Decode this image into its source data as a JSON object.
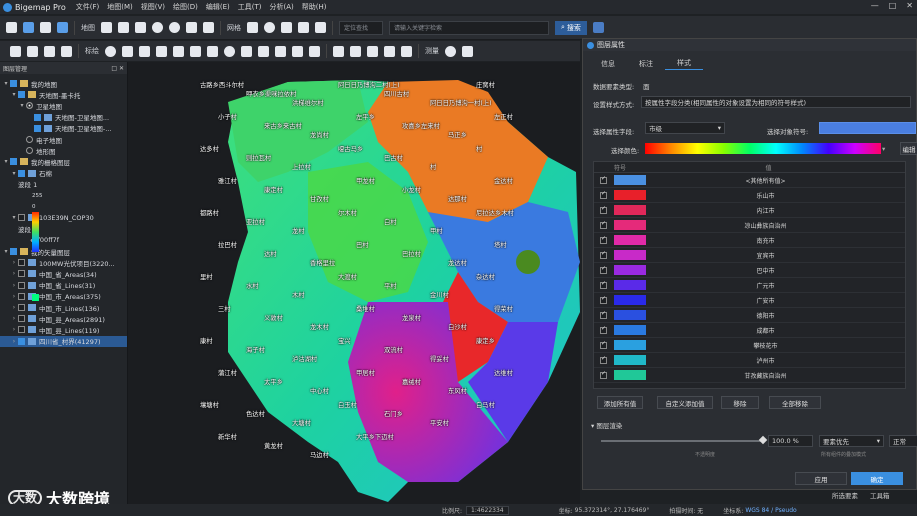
{
  "app": {
    "title": "Bigemap Pro",
    "menu": [
      "文件(F)",
      "地图(M)",
      "视图(V)",
      "绘图(D)",
      "编辑(E)",
      "工具(T)",
      "分析(A)",
      "帮助(H)"
    ]
  },
  "toolbar1": {
    "map_label": "地图",
    "grid_label": "网格",
    "search_mode": "定位查找",
    "search_placeholder": "请输入关键字检索",
    "search_btn": "搜索"
  },
  "toolbar2": {
    "mark_label": "标绘",
    "measure_label": "测量"
  },
  "sidebar": {
    "header": "图层管理",
    "rows": [
      {
        "indent": 1,
        "exp": "▾",
        "cb": true,
        "icon": "folder",
        "label": "我的地图"
      },
      {
        "indent": 2,
        "exp": "▾",
        "cb": true,
        "icon": "folder",
        "label": "天地图-墨卡托"
      },
      {
        "indent": 3,
        "exp": "▾",
        "radio": true,
        "on": true,
        "label": "卫星地图"
      },
      {
        "indent": 4,
        "exp": "",
        "cb": true,
        "icon": "layer",
        "label": "天地图-卫星地图..."
      },
      {
        "indent": 4,
        "exp": "",
        "cb": true,
        "icon": "layer",
        "label": "天地图-卫星地图-..."
      },
      {
        "indent": 3,
        "exp": "",
        "radio": true,
        "on": false,
        "label": "电子地图"
      },
      {
        "indent": 3,
        "exp": "",
        "radio": true,
        "on": false,
        "label": "地形图"
      },
      {
        "indent": 1,
        "exp": "▾",
        "cb": true,
        "icon": "folder",
        "label": "我的栅格图层"
      },
      {
        "indent": 2,
        "exp": "▾",
        "cb": true,
        "icon": "layer",
        "label": "石棉"
      },
      {
        "indent": 2,
        "exp": "",
        "label": "波段 1"
      },
      {
        "indent": 2,
        "exp": "",
        "label": "255"
      },
      {
        "indent": 2,
        "exp": "",
        "label": "0"
      },
      {
        "indent": 2,
        "exp": "▾",
        "cb": false,
        "icon": "layer",
        "label": "103E39N_COP30"
      },
      {
        "indent": 2,
        "exp": "",
        "label": "波段 1"
      },
      {
        "indent": 2,
        "exp": "",
        "label": "#ff00ff7f"
      },
      {
        "indent": 1,
        "exp": "▾",
        "cb": true,
        "icon": "folder",
        "label": "我的矢量图层"
      },
      {
        "indent": 2,
        "exp": "›",
        "cb": false,
        "icon": "layer",
        "label": "100MW光伏项目(3220..."
      },
      {
        "indent": 2,
        "exp": "›",
        "cb": false,
        "icon": "layer",
        "label": "中国_省_Areas(34)"
      },
      {
        "indent": 2,
        "exp": "›",
        "cb": false,
        "icon": "layer",
        "label": "中国_省_Lines(31)"
      },
      {
        "indent": 2,
        "exp": "›",
        "cb": false,
        "icon": "layer",
        "label": "中国_市_Areas(375)"
      },
      {
        "indent": 2,
        "exp": "›",
        "cb": false,
        "icon": "layer",
        "label": "中国_市_Lines(136)"
      },
      {
        "indent": 2,
        "exp": "›",
        "cb": false,
        "icon": "layer",
        "label": "中国_县_Areas(2891)"
      },
      {
        "indent": 2,
        "exp": "›",
        "cb": false,
        "icon": "layer",
        "label": "中国_县_Lines(119)"
      },
      {
        "indent": 2,
        "exp": "›",
        "cb": true,
        "icon": "layer",
        "label": "四川省_村界(41297)",
        "selected": true
      }
    ]
  },
  "map_labels": [
    "古路乡西斗尔村",
    "呷衣乡渠咪拉依村",
    "洪梯维尔村",
    "阿日日乃博沟二村(上)",
    "四川古村",
    "阿日日乃博沟一村(上)",
    "庄窝村",
    "小子村",
    "来古乡来古村",
    "龙尚村",
    "左平乡",
    "攻喜乡左来村",
    "马正乡",
    "左正村",
    "达多村",
    "则拉瓦村",
    "上拉村",
    "嗄古马乡",
    "巴古村",
    "村",
    "村",
    "雅江村",
    "康定村",
    "甘孜村",
    "甲龙村",
    "小龙村",
    "达那村",
    "金达村",
    "都路村",
    "亚拉村",
    "龙村",
    "尔木村",
    "白村",
    "甲村",
    "尼拉达乡木村",
    "拉巴村",
    "达村",
    "香格里拉",
    "巴村",
    "巴拉村",
    "龙达村",
    "塔村",
    "里村",
    "水村",
    "木村",
    "大渡村",
    "平村",
    "金川村",
    "杂达村",
    "三村",
    "义敦村",
    "龙木村",
    "桑堆村",
    "龙泉村",
    "白沙村",
    "得荣村",
    "康村",
    "海子村",
    "泸沽湖村",
    "宝兴",
    "双流村",
    "得妥村",
    "康定乡",
    "蒲江村",
    "太平乡",
    "中心村",
    "甲居村",
    "嘉绒村",
    "东风村",
    "达维村",
    "壤塘村",
    "色达村",
    "大塘村",
    "白玉村",
    "石门乡",
    "平安村",
    "白马村",
    "新华村",
    "黄龙村",
    "马边村",
    "大平乡下迈村"
  ],
  "status": {
    "scale_label": "比例尺:",
    "scale": "1:4622334",
    "coords_label": "坐标:",
    "coords": "95.372314°, 27.176469°",
    "alt_label": "拍摄时间: 无",
    "crs_label": "坐标系:",
    "crs": "WGS 84 / Pseudo"
  },
  "watermark": {
    "logo": "大数",
    "text": "大数跨境"
  },
  "dialog": {
    "title": "图层属性",
    "tabs": [
      "信息",
      "标注",
      "样式"
    ],
    "data_type_label": "数据要素类型:",
    "data_type_value": "面",
    "style_mode_label": "设置样式方式:",
    "style_mode_value": "按属性字段分类(相同属性的对象设置为相同的符号样式)",
    "field_label": "选择属性字段:",
    "field_value": "市级",
    "symbol_label": "选择对象符号:",
    "color_label": "选择颜色:",
    "edit_label": "编辑",
    "table_head": {
      "symbol": "符号",
      "value": "值"
    },
    "table_rows": [
      {
        "color": "#4a90e2",
        "value": "<其他所有值>"
      },
      {
        "color": "#e8202a",
        "value": "乐山市"
      },
      {
        "color": "#e0285a",
        "value": "内江市"
      },
      {
        "color": "#e52a7a",
        "value": "凉山彝族自治州"
      },
      {
        "color": "#e02aa8",
        "value": "南充市"
      },
      {
        "color": "#c82ac8",
        "value": "宜宾市"
      },
      {
        "color": "#9a2ae0",
        "value": "巴中市"
      },
      {
        "color": "#5a2ae8",
        "value": "广元市"
      },
      {
        "color": "#2a2ae8",
        "value": "广安市"
      },
      {
        "color": "#2a50e0",
        "value": "德阳市"
      },
      {
        "color": "#2a7ae0",
        "value": "成都市"
      },
      {
        "color": "#2aa0e0",
        "value": "攀枝花市"
      },
      {
        "color": "#20b8c8",
        "value": "泸州市"
      },
      {
        "color": "#20c898",
        "value": "甘孜藏族自治州"
      }
    ],
    "btn_add_all": "添加所有值",
    "btn_add_custom": "自定义添加值",
    "btn_remove": "移除",
    "btn_remove_all": "全部移除",
    "render_label": "图层渲染",
    "opacity_value": "100.0 %",
    "priority_value": "要素优先",
    "normal_value": "正常",
    "opacity_hint": "不透明度",
    "priority_hint": "所有组件的叠加模式",
    "btn_apply": "应用",
    "btn_ok": "确定",
    "bottom_tabs": [
      "所选要素",
      "工具箱"
    ]
  },
  "colors": {
    "accent": "#3a8fe0",
    "bg": "#1e2124",
    "panel": "#2b2e33"
  }
}
